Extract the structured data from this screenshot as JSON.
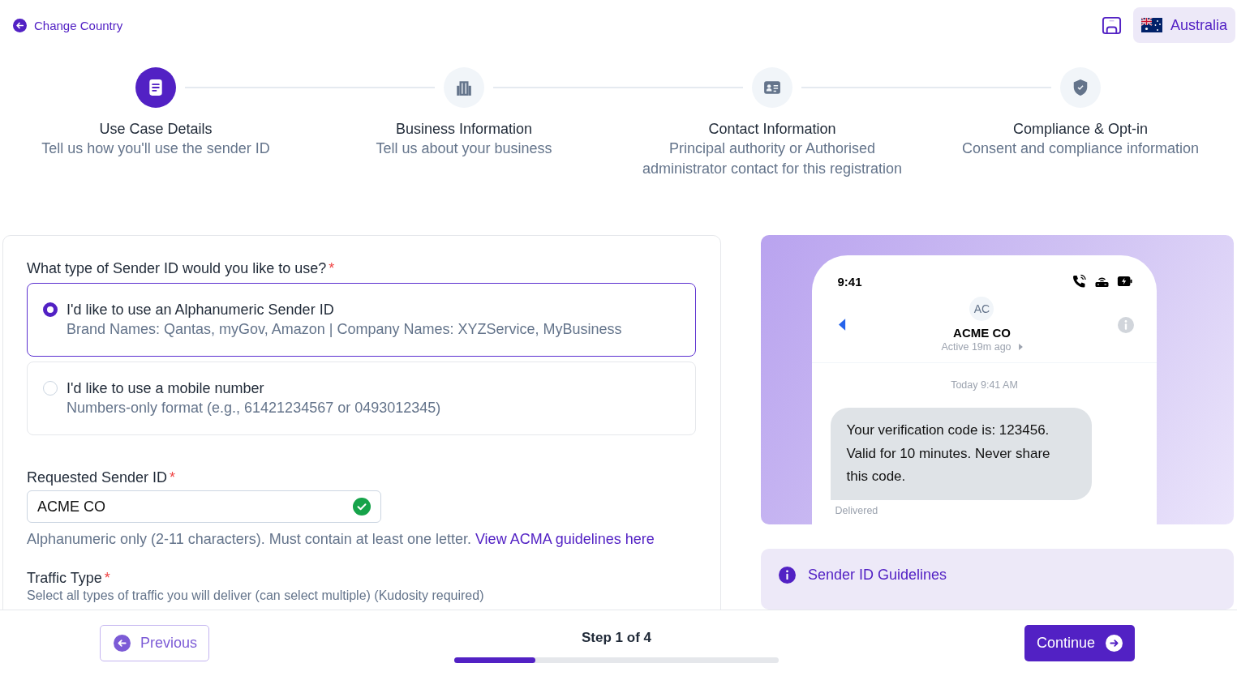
{
  "header": {
    "back_link": "Change Country",
    "country": "Australia"
  },
  "steps": [
    {
      "kind": "document",
      "title": "Use Case Details",
      "subtitle": "Tell us how you'll use the sender ID",
      "selected": true
    },
    {
      "kind": "building",
      "title": "Business Information",
      "subtitle": "Tell us about your business",
      "selected": false
    },
    {
      "kind": "contact",
      "title": "Contact Information",
      "subtitle": "Principal authority or Authorised administrator contact for this registration",
      "selected": false
    },
    {
      "kind": "shield",
      "title": "Compliance & Opt-in",
      "subtitle": "Consent and compliance information",
      "selected": false
    }
  ],
  "form": {
    "question": "What type of Sender ID would you like to use?",
    "question_mark": "*",
    "options": [
      {
        "title": "I'd like to use an Alphanumeric Sender ID",
        "description": "Brand Names: Qantas, myGov, Amazon | Company Names: XYZService, MyBusiness",
        "selected": true
      },
      {
        "title": "I'd like to use a mobile number",
        "description": "Numbers-only format (e.g., 61421234567 or 0493012345)",
        "selected": false
      }
    ],
    "sender_id": {
      "label": "Requested Sender ID",
      "required_mark": "*",
      "value": "ACME CO",
      "valid": true
    },
    "help_text": "Alphanumeric only (2-11 characters). Must contain at least one letter.",
    "help_link": "View ACMA guidelines here",
    "traffic": {
      "label": "Traffic Type",
      "required_mark": "*",
      "hint": "Select all types of traffic you will deliver (can select multiple) (Kudosity required)"
    }
  },
  "preview": {
    "time": "9:41",
    "avatar": "AC",
    "contact": "ACME CO",
    "status": "Active 19m ago",
    "timestamp": "Today 9:41 AM",
    "message": "Your verification code is: 123456. Valid for 10 minutes. Never share this code.",
    "delivery": "Delivered"
  },
  "guidelines": {
    "title": "Sender ID Guidelines"
  },
  "footer": {
    "previous": "Previous",
    "step": "Step 1 of 4",
    "progress": {
      "level": 0.25
    },
    "continue": "Continue"
  }
}
